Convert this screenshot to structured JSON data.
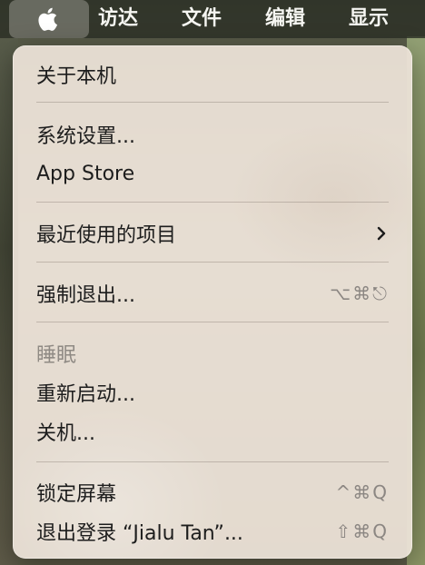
{
  "menubar": {
    "apple_icon": "apple-logo-icon",
    "items": [
      "访达",
      "文件",
      "编辑",
      "显示"
    ]
  },
  "menu": {
    "about": "关于本机",
    "system_settings": "系统设置...",
    "app_store": "App Store",
    "recent_items": "最近使用的项目",
    "force_quit": "强制退出...",
    "force_quit_shortcut": "⌥⌘⎋",
    "sleep": "睡眠",
    "restart": "重新启动...",
    "shutdown": "关机...",
    "lock_screen": "锁定屏幕",
    "lock_screen_shortcut": "^⌘Q",
    "logout": "退出登录 “Jialu Tan”...",
    "logout_shortcut": "⇧⌘Q"
  },
  "colors": {
    "menu_bg": "#ece2d8",
    "text": "#1d1d1d",
    "disabled": "#8f8a84"
  }
}
